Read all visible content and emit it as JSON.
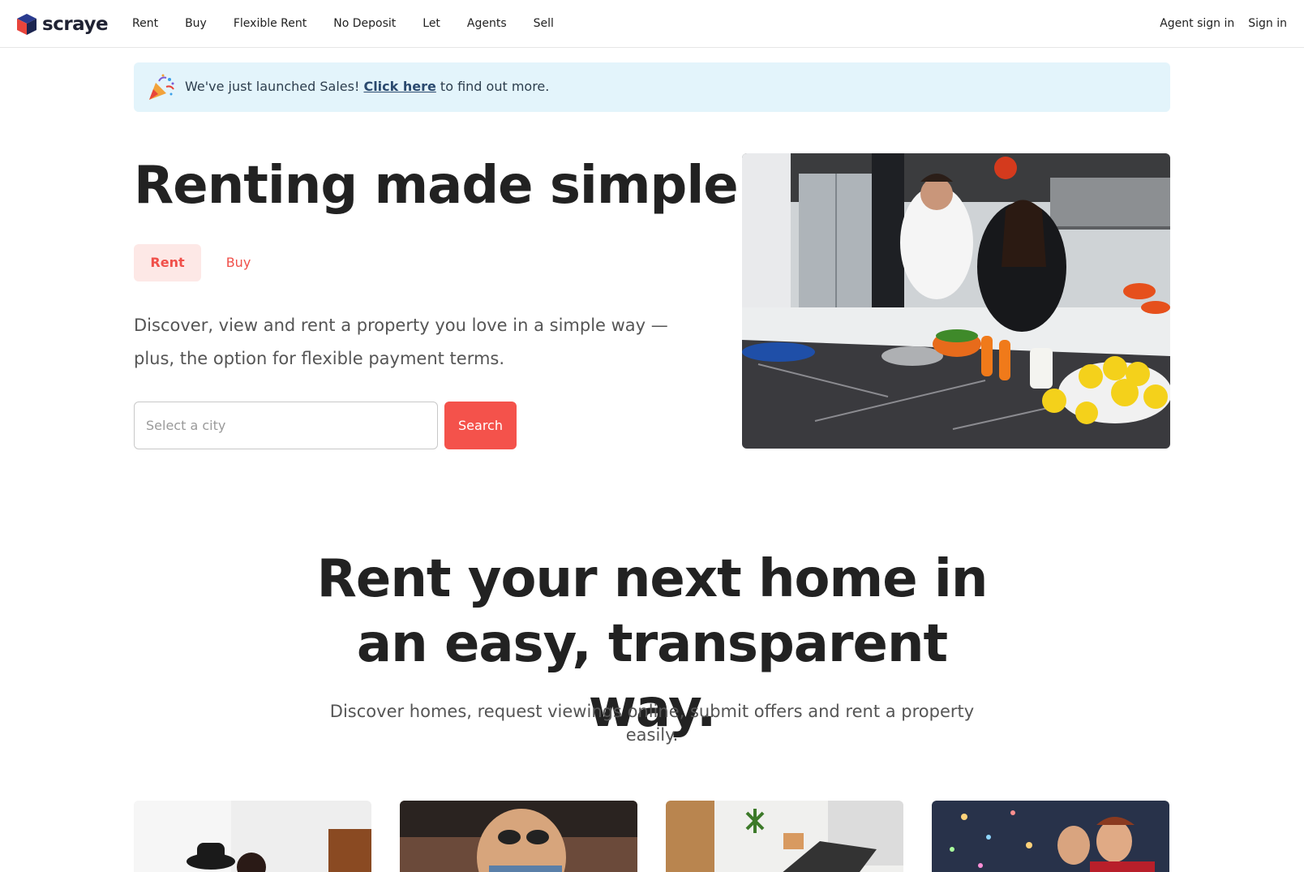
{
  "brand": {
    "name": "scraye"
  },
  "nav": {
    "links": [
      "Rent",
      "Buy",
      "Flexible Rent",
      "No Deposit",
      "Let",
      "Agents",
      "Sell"
    ],
    "agent_sign_in": "Agent sign in",
    "sign_in": "Sign in"
  },
  "banner": {
    "text_before": "We've just launched Sales! ",
    "link": "Click here",
    "text_after": " to find out more."
  },
  "hero": {
    "title": "Renting made simple.",
    "tabs": {
      "rent": "Rent",
      "buy": "Buy"
    },
    "description": "Discover, view and rent a property you love in a simple way —plus, the option for flexible payment terms.",
    "search_placeholder": "Select a city",
    "search_button": "Search"
  },
  "section": {
    "title": "Rent your next home in an easy, transparent way.",
    "description": "Discover homes, request viewings online, submit offers and rent a property easily."
  },
  "colors": {
    "accent": "#f4524b",
    "tab_bg": "#fde8e6",
    "banner_bg": "#e3f4fb"
  }
}
